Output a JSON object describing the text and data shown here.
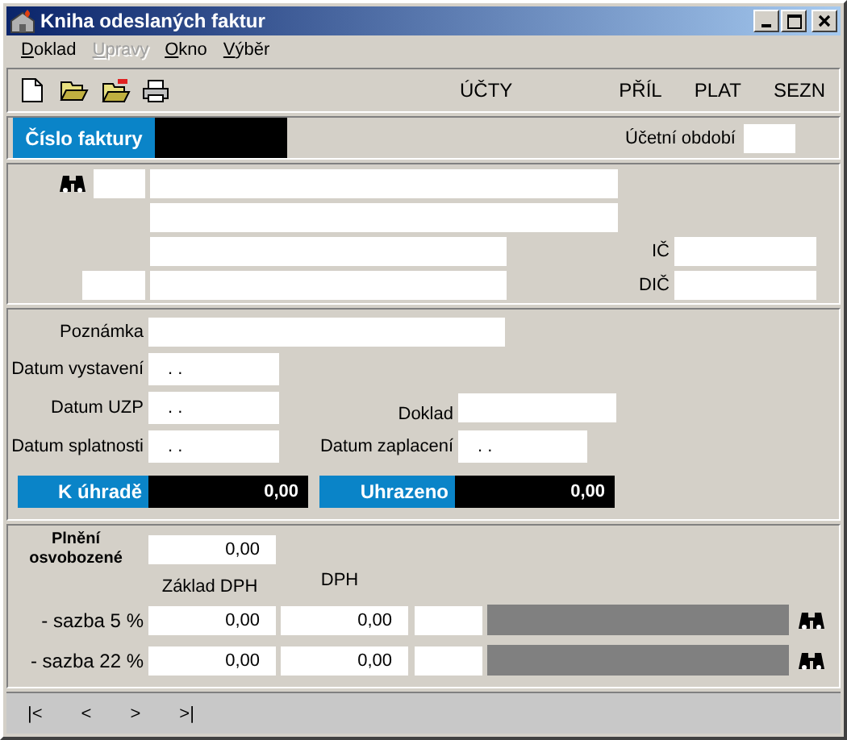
{
  "window": {
    "title": "Kniha odeslaných faktur"
  },
  "menu": [
    {
      "label": "Doklad",
      "disabled": false
    },
    {
      "label": "Upravy",
      "disabled": true
    },
    {
      "label": "Okno",
      "disabled": false
    },
    {
      "label": "Výběr",
      "disabled": false
    }
  ],
  "toolbar": {
    "buttons": [
      "ÚČTY",
      "PŘÍL",
      "PLAT",
      "SEZN"
    ]
  },
  "header": {
    "invoice_label": "Číslo faktury",
    "period_label": "Účetní období"
  },
  "partner": {
    "ic_label": "IČ",
    "dic_label": "DIČ"
  },
  "details": {
    "note_label": "Poznámka",
    "dates": [
      {
        "label": "Datum vystavení",
        "value": ". ."
      },
      {
        "label": "Datum UZP",
        "value": ". ."
      },
      {
        "label": "Datum splatnosti",
        "value": ". ."
      }
    ],
    "document_label": "Doklad",
    "payment_date": {
      "label": "Datum zaplacení",
      "value": ". ."
    }
  },
  "totals": [
    {
      "label": "K úhradě",
      "value": "0,00"
    },
    {
      "label": "Uhrazeno",
      "value": "0,00"
    }
  ],
  "vat": {
    "exempt": {
      "label": "Plnění osvobozené",
      "value": "0,00"
    },
    "headers": [
      "Základ DPH",
      "DPH"
    ],
    "rows": [
      {
        "label": "- sazba 5 %",
        "base": "0,00",
        "vat": "0,00"
      },
      {
        "label": "- sazba 22 %",
        "base": "0,00",
        "vat": "0,00"
      }
    ]
  },
  "navigation": [
    "|<",
    "<",
    ">",
    ">|"
  ]
}
